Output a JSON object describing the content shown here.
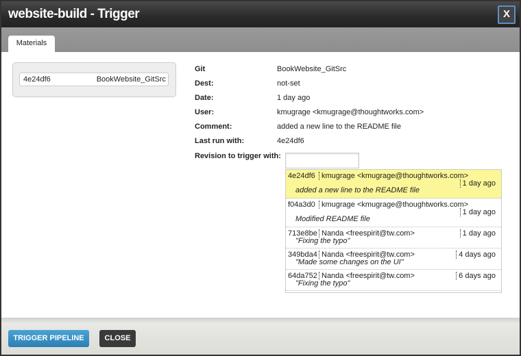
{
  "window": {
    "title": "website-build - Trigger",
    "close_label": "X"
  },
  "tabs": [
    {
      "label": "Materials"
    }
  ],
  "material": {
    "revision": "4e24df6",
    "name": "BookWebsite_GitSrc"
  },
  "details": [
    {
      "label": "Git",
      "value": "BookWebsite_GitSrc"
    },
    {
      "label": "Dest:",
      "value": "not-set"
    },
    {
      "label": "Date:",
      "value": "1 day ago"
    },
    {
      "label": "User:",
      "value": "kmugrage <kmugrage@thoughtworks.com>"
    },
    {
      "label": "Comment:",
      "value": "added a new line to the README file"
    },
    {
      "label": "Last run with:",
      "value": "4e24df6"
    }
  ],
  "revision_label": "Revision to trigger with:",
  "revision_value": "",
  "revisions": [
    {
      "rev": "4e24df6",
      "user": "kmugrage <kmugrage@thoughtworks.com>",
      "time": "1 day ago",
      "comment": "added a new line to the README file",
      "selected": true
    },
    {
      "rev": "f04a3d0",
      "user": "kmugrage <kmugrage@thoughtworks.com>",
      "time": "1 day ago",
      "comment": "Modified README file"
    },
    {
      "rev": "713e8be",
      "user": "Nanda <freespirit@tw.com>",
      "time": "1 day ago",
      "comment": "\"Fixing the typo\""
    },
    {
      "rev": "349bda4",
      "user": "Nanda <freespirit@tw.com>",
      "time": "4 days ago",
      "comment": "\"Made some changes on the UI\""
    },
    {
      "rev": "64da752",
      "user": "Nanda <freespirit@tw.com>",
      "time": "6 days ago",
      "comment": "\"Fixing the typo\""
    }
  ],
  "footer": {
    "trigger_label": "TRIGGER PIPELINE",
    "close_label": "CLOSE"
  },
  "colors": {
    "accent": "#2c7fb3",
    "selected_row": "#fbf697"
  }
}
